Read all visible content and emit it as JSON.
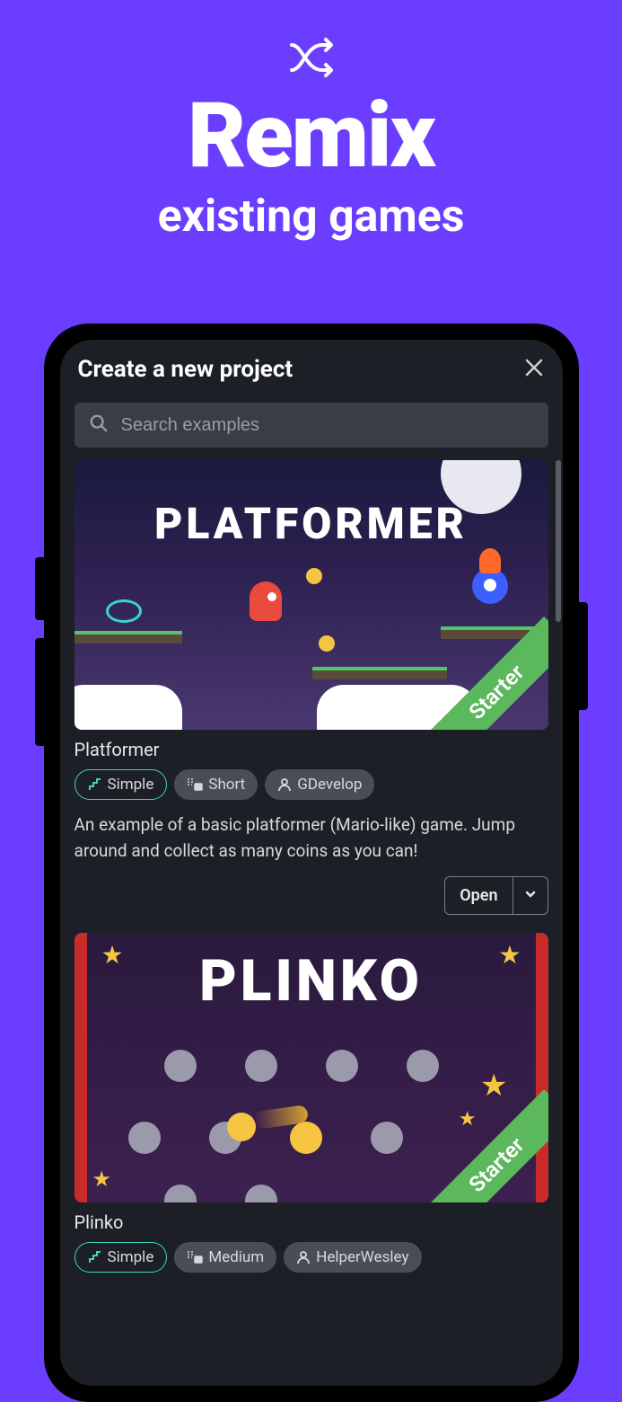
{
  "hero": {
    "title": "Remix",
    "subtitle": "existing games"
  },
  "screen": {
    "header_title": "Create a new project",
    "search_placeholder": "Search examples",
    "starter_label": "Starter",
    "open_label": "Open"
  },
  "examples": [
    {
      "overlay_title": "PLATFORMER",
      "title": "Platformer",
      "tags": {
        "difficulty": "Simple",
        "length": "Short",
        "author": "GDevelop"
      },
      "description": "An example of a basic platformer (Mario-like) game. Jump around and collect as many coins as you can!"
    },
    {
      "overlay_title": "PLINKO",
      "title": "Plinko",
      "tags": {
        "difficulty": "Simple",
        "length": "Medium",
        "author": "HelperWesley"
      }
    }
  ]
}
